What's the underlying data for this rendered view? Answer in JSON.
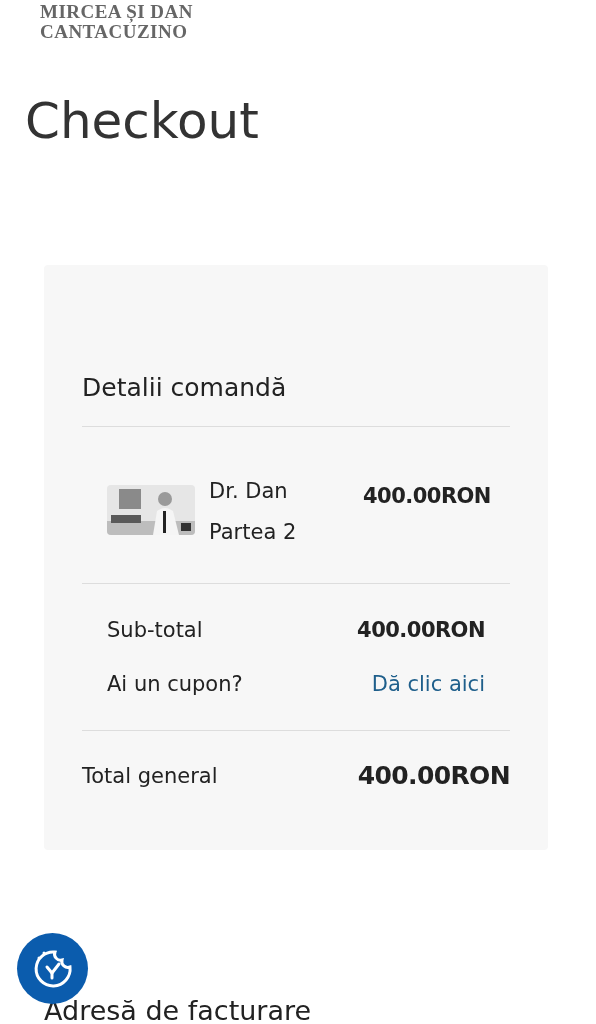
{
  "logo": {
    "lines": [
      "MIRCEA ȘI DAN",
      "CANTACUZINO"
    ]
  },
  "page_title": "Checkout",
  "order": {
    "title": "Detalii comandă",
    "items": [
      {
        "name": "Dr. Dan Partea 2",
        "price": "400.00RON"
      }
    ],
    "subtotal": {
      "label": "Sub-total",
      "value": "400.00RON"
    },
    "coupon": {
      "label": "Ai un cupon?",
      "link": "Dă clic aici"
    },
    "total": {
      "label": "Total general",
      "value": "400.00RON"
    }
  },
  "billing": {
    "title": "Adresă de facturare"
  }
}
